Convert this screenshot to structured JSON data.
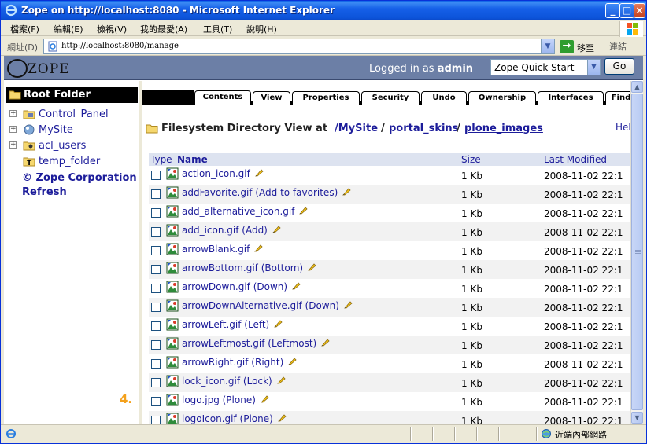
{
  "window": {
    "title": "Zope on http://localhost:8080 - Microsoft Internet Explorer"
  },
  "menu": {
    "items": [
      "檔案(F)",
      "編輯(E)",
      "檢視(V)",
      "我的最愛(A)",
      "工具(T)",
      "說明(H)"
    ]
  },
  "address": {
    "label": "網址(D)",
    "url": "http://localhost:8080/manage",
    "go_label": "移至",
    "links_label": "連結"
  },
  "header": {
    "logo_text": "ZOPE",
    "logged_in_prefix": "Logged in as",
    "user": "admin",
    "quick_start": "Zope Quick Start",
    "go": "Go"
  },
  "nav": {
    "root": "Root Folder",
    "items": [
      "Control_Panel",
      "MySite",
      "acl_users",
      "temp_folder"
    ],
    "copyright": "© Zope Corporation",
    "refresh": "Refresh"
  },
  "tabs": [
    "Contents",
    "View",
    "Properties",
    "Security",
    "Undo",
    "Ownership",
    "Interfaces",
    "Find"
  ],
  "main": {
    "view_label": "Filesystem Directory View at",
    "path_root": "/MySite",
    "path_mid": "portal_skins",
    "path_last": "plone_images",
    "sep": "/",
    "help": "Help!"
  },
  "table": {
    "headers": {
      "type": "Type",
      "name": "Name",
      "size": "Size",
      "modified": "Last Modified"
    },
    "rows": [
      {
        "name": "action_icon.gif",
        "size": "1 Kb",
        "modified": "2008-11-02 22:1"
      },
      {
        "name": "addFavorite.gif (Add to favorites)",
        "size": "1 Kb",
        "modified": "2008-11-02 22:1"
      },
      {
        "name": "add_alternative_icon.gif",
        "size": "1 Kb",
        "modified": "2008-11-02 22:1"
      },
      {
        "name": "add_icon.gif (Add)",
        "size": "1 Kb",
        "modified": "2008-11-02 22:1"
      },
      {
        "name": "arrowBlank.gif",
        "size": "1 Kb",
        "modified": "2008-11-02 22:1"
      },
      {
        "name": "arrowBottom.gif (Bottom)",
        "size": "1 Kb",
        "modified": "2008-11-02 22:1"
      },
      {
        "name": "arrowDown.gif (Down)",
        "size": "1 Kb",
        "modified": "2008-11-02 22:1"
      },
      {
        "name": "arrowDownAlternative.gif (Down)",
        "size": "1 Kb",
        "modified": "2008-11-02 22:1"
      },
      {
        "name": "arrowLeft.gif (Left)",
        "size": "1 Kb",
        "modified": "2008-11-02 22:1"
      },
      {
        "name": "arrowLeftmost.gif (Leftmost)",
        "size": "1 Kb",
        "modified": "2008-11-02 22:1"
      },
      {
        "name": "arrowRight.gif (Right)",
        "size": "1 Kb",
        "modified": "2008-11-02 22:1"
      },
      {
        "name": "lock_icon.gif (Lock)",
        "size": "1 Kb",
        "modified": "2008-11-02 22:1"
      },
      {
        "name": "logo.jpg (Plone)",
        "size": "1 Kb",
        "modified": "2008-11-02 22:1"
      },
      {
        "name": "logoIcon.gif (Plone)",
        "size": "1 Kb",
        "modified": "2008-11-02 22:1"
      }
    ]
  },
  "annotation": {
    "step": "4."
  },
  "status": {
    "zone": "近端內部網路"
  }
}
